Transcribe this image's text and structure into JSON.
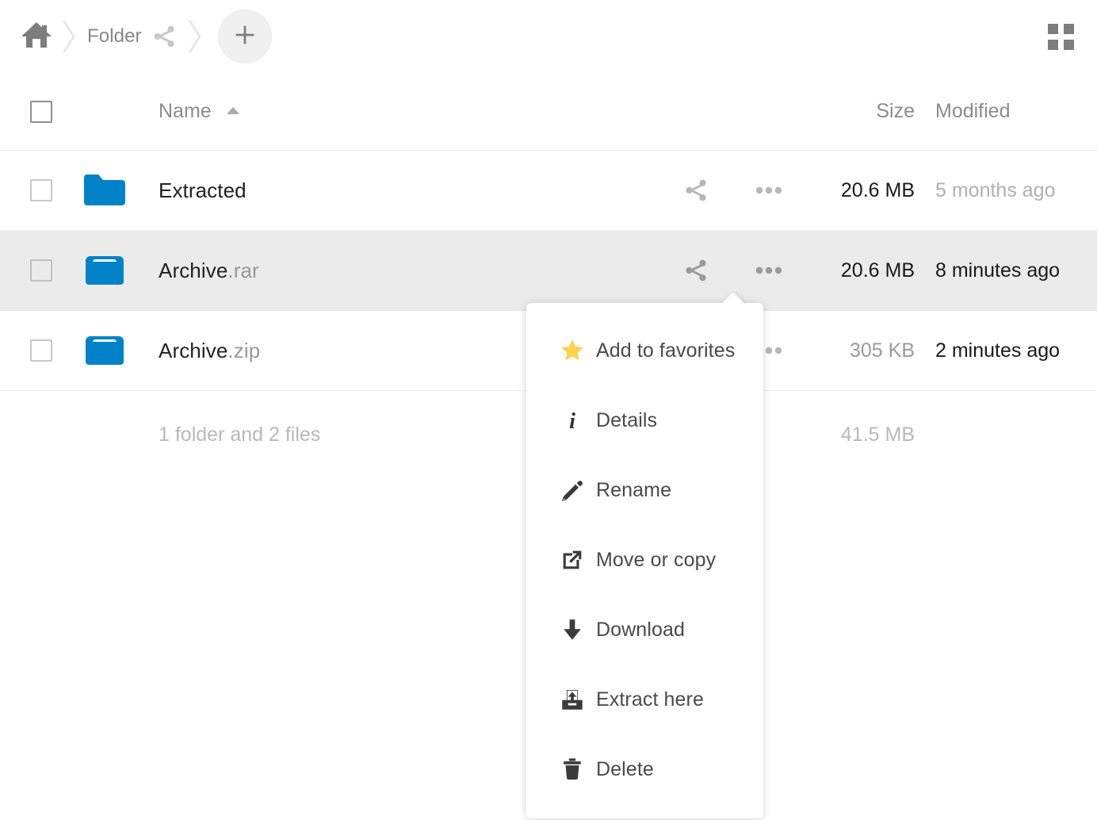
{
  "breadcrumb": {
    "home_icon": "home-icon",
    "separator_icon": "chevron-right-icon",
    "folder_label": "Folder",
    "share_icon": "share-icon",
    "new_button_icon": "plus-icon",
    "new_button_label": "+"
  },
  "viewtoggle": {
    "icon": "grid-view-icon"
  },
  "table": {
    "headers": {
      "select_all": "",
      "name": "Name",
      "sort_indicator": "sort-ascending-icon",
      "size": "Size",
      "modified": "Modified"
    },
    "rows": [
      {
        "icon": "folder-icon",
        "name": "Extracted",
        "ext": "",
        "size": "20.6 MB",
        "size_color": "#1a1a1a",
        "modified": "5 months ago",
        "modified_color": "#b0b0b0",
        "share_icon": "share-icon",
        "more_icon": "more-actions-icon",
        "selected": false
      },
      {
        "icon": "archive-icon",
        "name": "Archive",
        "ext": ".rar",
        "size": "20.6 MB",
        "size_color": "#1a1a1a",
        "modified": "8 minutes ago",
        "modified_color": "#1a1a1a",
        "share_icon": "share-icon",
        "more_icon": "more-actions-icon",
        "selected": true
      },
      {
        "icon": "archive-icon",
        "name": "Archive",
        "ext": ".zip",
        "size": "305 KB",
        "size_color": "#9a9a9a",
        "modified": "2 minutes ago",
        "modified_color": "#1a1a1a",
        "share_icon": "share-icon",
        "more_icon": "more-actions-icon",
        "selected": false
      }
    ],
    "summary": {
      "text": "1 folder and 2 files",
      "size": "41.5 MB"
    }
  },
  "context_menu": {
    "items": [
      {
        "icon": "star-icon",
        "label": "Add to favorites"
      },
      {
        "icon": "info-icon",
        "label": "Details"
      },
      {
        "icon": "pencil-icon",
        "label": "Rename"
      },
      {
        "icon": "external-link-icon",
        "label": "Move or copy"
      },
      {
        "icon": "download-icon",
        "label": "Download"
      },
      {
        "icon": "extract-icon",
        "label": "Extract here"
      },
      {
        "icon": "trash-icon",
        "label": "Delete"
      }
    ]
  },
  "colors": {
    "accent_blue": "#0082c9",
    "star_yellow": "#fcd34d",
    "selected_row": "#ebebeb",
    "icon_gray": "#b7b7b7",
    "icon_gray_dark": "#9b9b9b"
  }
}
